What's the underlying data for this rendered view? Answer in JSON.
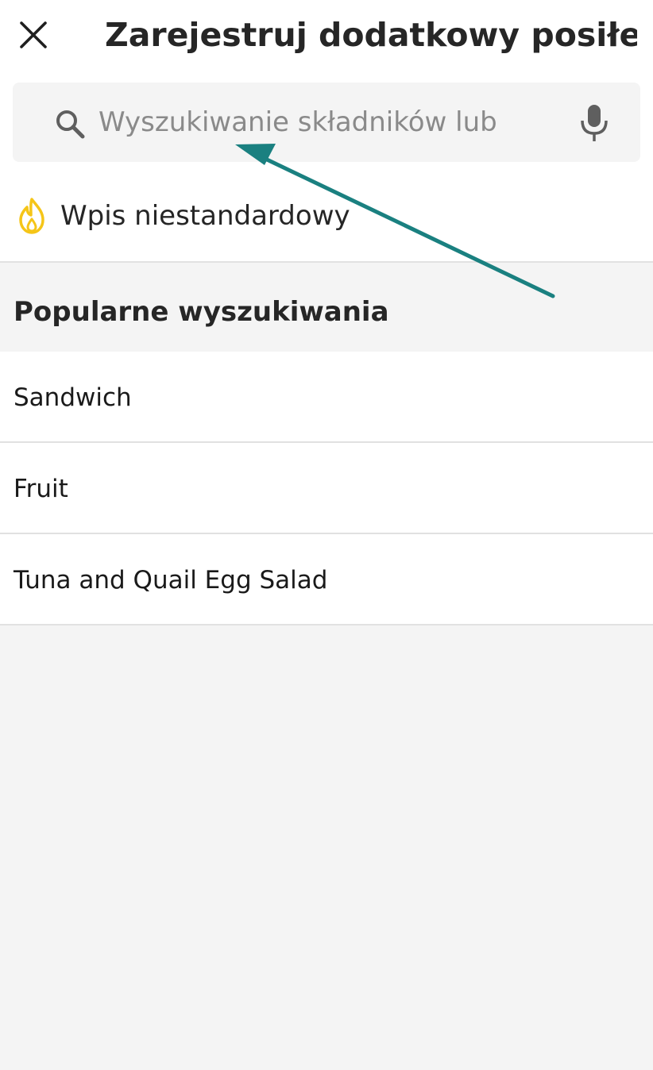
{
  "header": {
    "title": "Zarejestruj dodatkowy posiłek",
    "close_icon": "close-icon"
  },
  "search": {
    "placeholder": "Wyszukiwanie składników lub",
    "value": "",
    "search_icon": "search-icon",
    "mic_icon": "mic-icon"
  },
  "custom_entry": {
    "label": "Wpis niestandardowy",
    "icon": "flame-icon",
    "icon_color": "#f5c518"
  },
  "popular": {
    "title": "Popularne wyszukiwania",
    "items": [
      {
        "label": "Sandwich"
      },
      {
        "label": "Fruit"
      },
      {
        "label": "Tuna and Quail Egg Salad"
      }
    ]
  },
  "annotation": {
    "type": "arrow",
    "color": "#1a8080",
    "target": "search-input"
  }
}
